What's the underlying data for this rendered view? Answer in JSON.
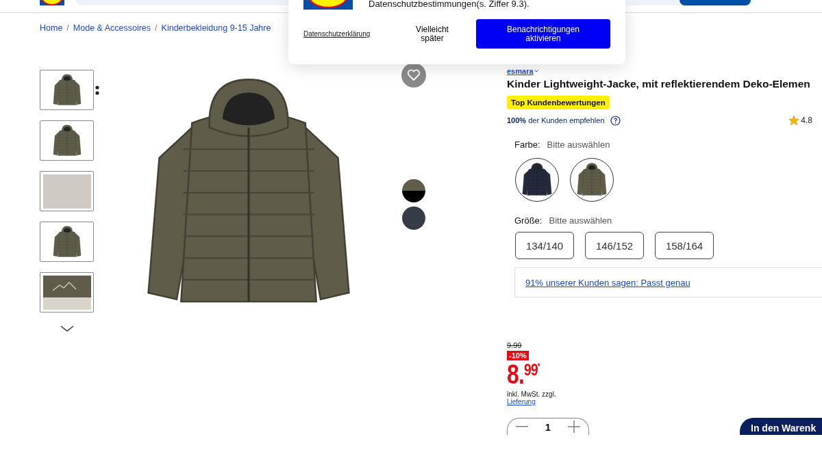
{
  "popup": {
    "text": "Datenschutzbestimmungen(s. Ziffer 9.3).",
    "privacy_link": "Datenschutzerklärung",
    "later_button": "Vielleicht später",
    "activate_button": "Benachrichtigungen aktivieren"
  },
  "breadcrumb": [
    "Home",
    "Mode & Accessoires",
    "Kinderbekleidung 9-15 Jahre"
  ],
  "breadcrumb_separator": "/",
  "gallery": {
    "thumbnails": [
      {
        "kind": "front"
      },
      {
        "kind": "front"
      },
      {
        "kind": "photo"
      },
      {
        "kind": "back"
      },
      {
        "kind": "detail"
      }
    ],
    "color_dots": [
      {
        "kind": "split",
        "color": "#5f5d4a"
      },
      {
        "kind": "plain",
        "color": "#363b48"
      }
    ]
  },
  "product": {
    "brand": "esmara",
    "title": "Kinder Lightweight-Jacke, mit reflektierendem Deko-Elemen",
    "badge": "Top Kundenbewertungen",
    "recommend_bold": "100%",
    "recommend_text": "der Kunden empfehlen",
    "rating": "4.8",
    "color_label": "Farbe:",
    "color_hint": "Bitte auswählen",
    "colors": [
      {
        "color": "#232a3b",
        "selected": false
      },
      {
        "color": "#5f5d4a",
        "selected": false
      }
    ],
    "size_label": "Größe:",
    "size_hint": "Bitte auswählen",
    "sizes": [
      {
        "label": "134/140",
        "selected": false
      },
      {
        "label": "146/152",
        "selected": false
      },
      {
        "label": "158/164",
        "selected": false
      }
    ],
    "fit_link": "91% unserer Kunden sagen: Passt genau",
    "old_price": "9.99",
    "discount": "-10%",
    "price_main": "8.",
    "price_cents": "99",
    "price_mark": "*",
    "tax_note": "inkl. MwSt. zzgl.",
    "delivery_link": "Lieferung",
    "quantity": "1",
    "cart_button": "In den Warenk"
  }
}
